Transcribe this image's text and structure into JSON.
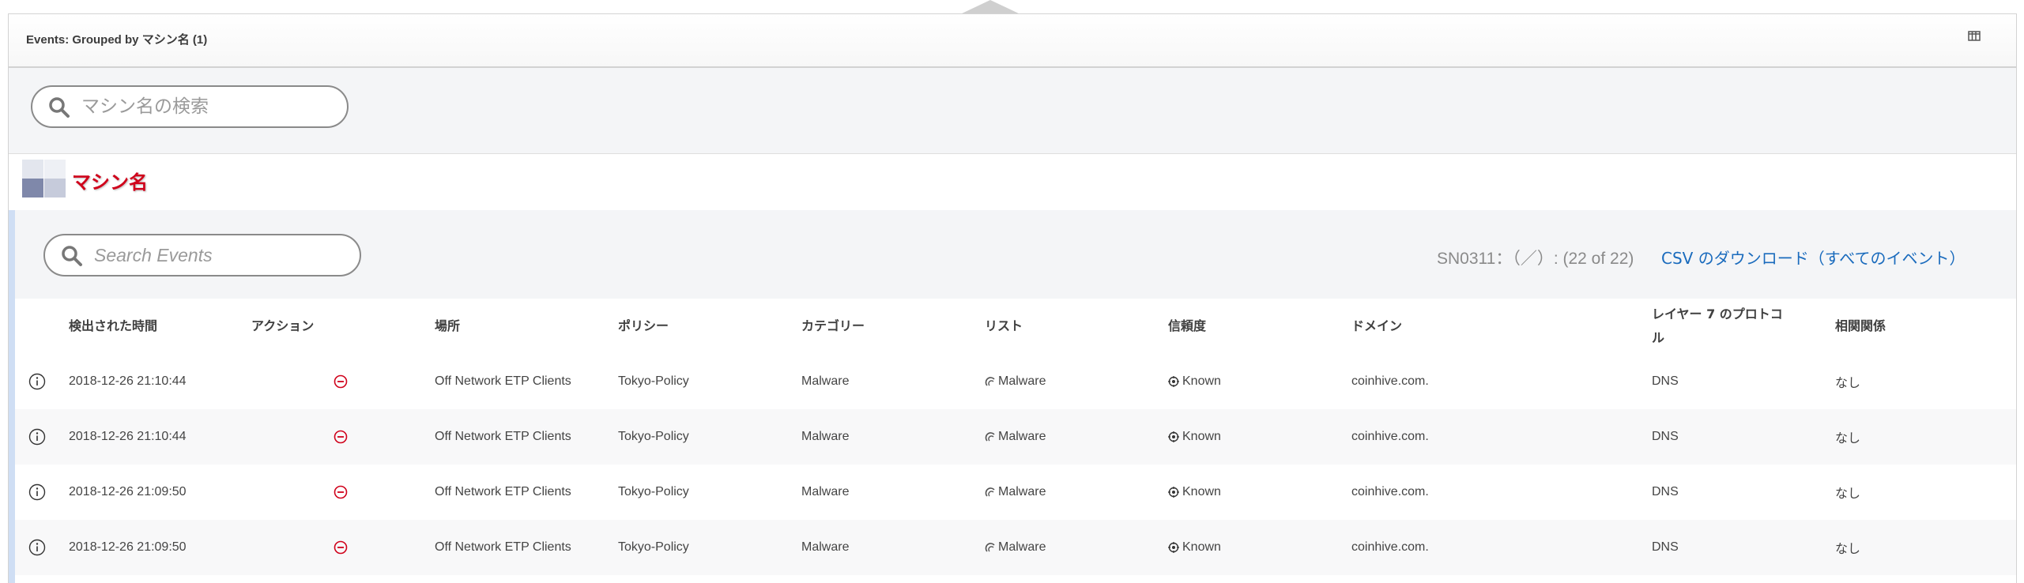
{
  "panel": {
    "title": "Events: Grouped by マシン名 (1)",
    "columns_icon": "columns-icon"
  },
  "machine_search": {
    "placeholder": "マシン名の検索",
    "icon": "search-icon"
  },
  "group": {
    "name": "マシン名",
    "avatar_colors": [
      "#e3e6ee",
      "#eef0f5",
      "#7f88aa",
      "#c6cbdb"
    ]
  },
  "events_toolbar": {
    "search_placeholder": "Search Events",
    "record_count": "SN0311：（／）: (22 of 22)",
    "csv_label": "CSV のダウンロード（すべてのイベント）"
  },
  "table": {
    "columns": [
      "",
      "検出された時間",
      "アクション",
      "場所",
      "ポリシー",
      "カテゴリー",
      "リスト",
      "信頼度",
      "ドメイン",
      "レイヤー 7 のプロトコル",
      "相関関係"
    ],
    "rows": [
      {
        "time": "2018-12-26 21:10:44",
        "action": "blocked",
        "location": "Off Network ETP Clients",
        "policy": "Tokyo-Policy",
        "category": "Malware",
        "list": "Malware",
        "confidence": "Known",
        "domain": "coinhive.com.",
        "protocol": "DNS",
        "correlation": "なし"
      },
      {
        "time": "2018-12-26 21:10:44",
        "action": "blocked",
        "location": "Off Network ETP Clients",
        "policy": "Tokyo-Policy",
        "category": "Malware",
        "list": "Malware",
        "confidence": "Known",
        "domain": "coinhive.com.",
        "protocol": "DNS",
        "correlation": "なし"
      },
      {
        "time": "2018-12-26 21:09:50",
        "action": "blocked",
        "location": "Off Network ETP Clients",
        "policy": "Tokyo-Policy",
        "category": "Malware",
        "list": "Malware",
        "confidence": "Known",
        "domain": "coinhive.com.",
        "protocol": "DNS",
        "correlation": "なし"
      },
      {
        "time": "2018-12-26 21:09:50",
        "action": "blocked",
        "location": "Off Network ETP Clients",
        "policy": "Tokyo-Policy",
        "category": "Malware",
        "list": "Malware",
        "confidence": "Known",
        "domain": "coinhive.com.",
        "protocol": "DNS",
        "correlation": "なし"
      }
    ]
  },
  "colors": {
    "accent_link": "#1a6bbd",
    "group_name": "#d0021b",
    "block_icon": "#d0021b",
    "section_border": "#cfdef4"
  }
}
